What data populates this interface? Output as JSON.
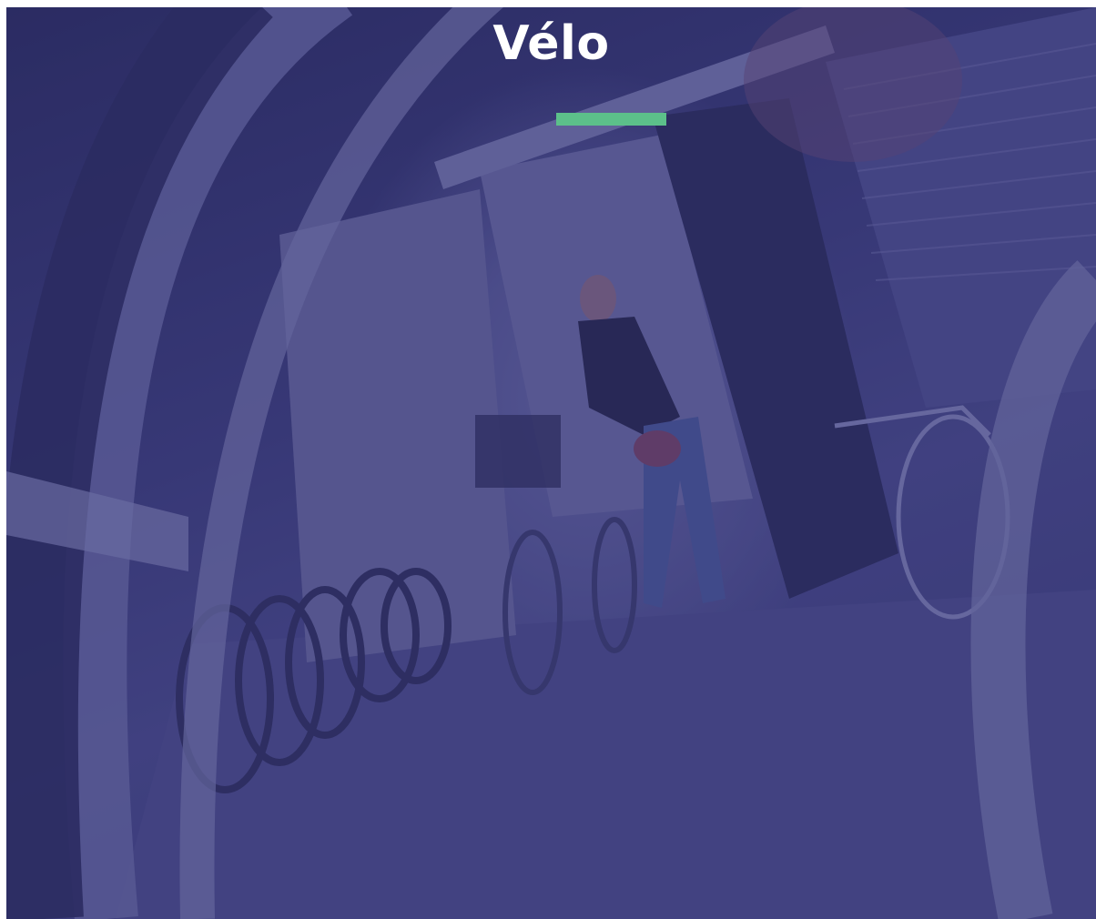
{
  "hero": {
    "title": "Vélo",
    "accent_color": "#5cc08a",
    "overlay_color": "#2d2e6e",
    "image": "bicycle-parking-photo"
  }
}
